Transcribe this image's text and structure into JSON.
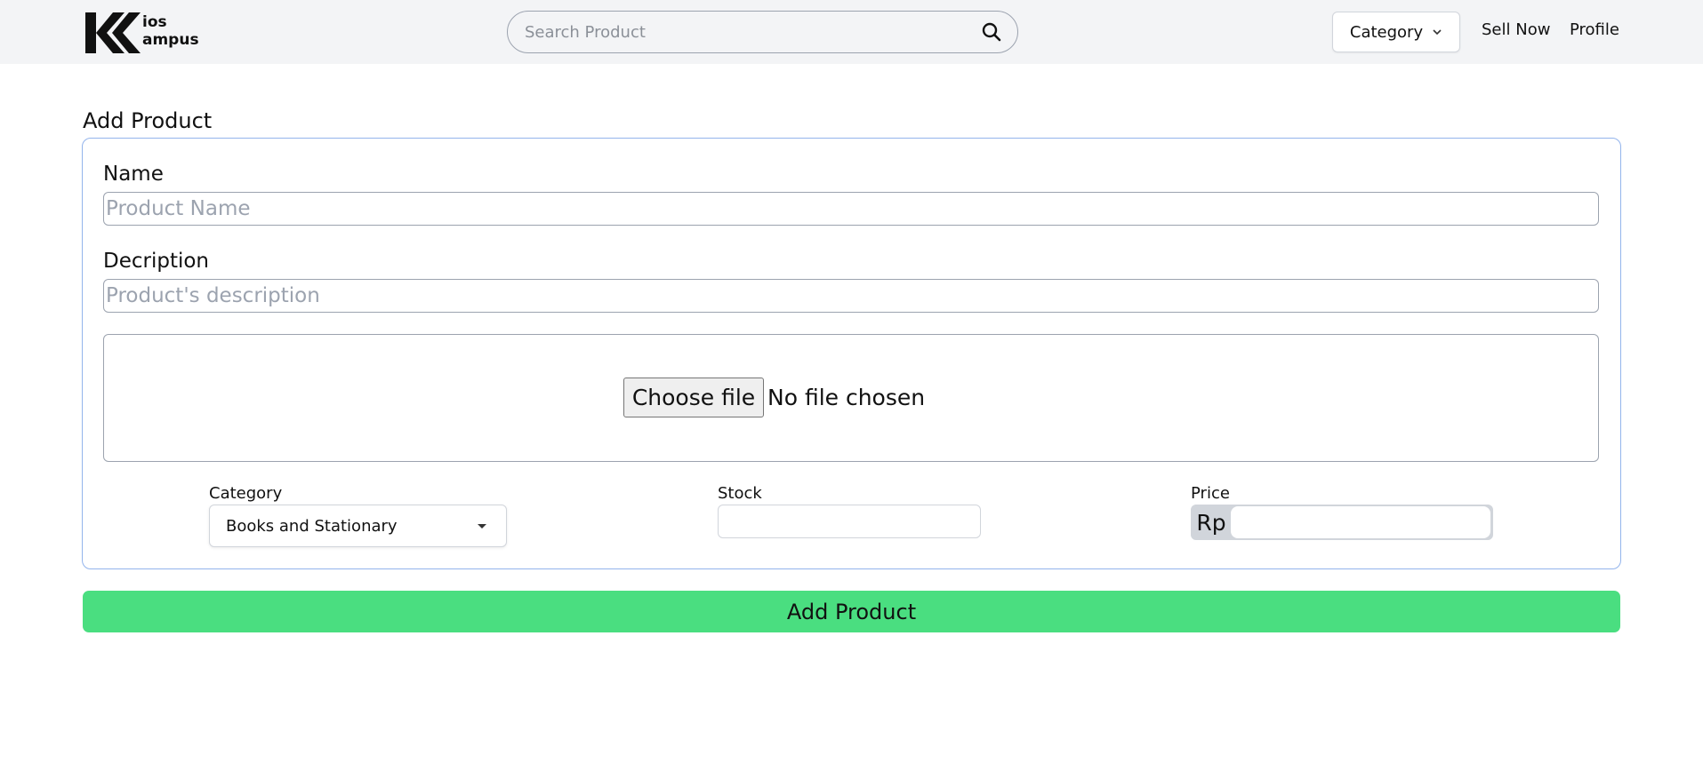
{
  "brand": {
    "line1": "ios",
    "line2": "ampus",
    "mark": "K"
  },
  "search": {
    "placeholder": "Search Product",
    "icon": "search-icon"
  },
  "nav": {
    "category_label": "Category",
    "sell_label": "Sell Now",
    "profile_label": "Profile"
  },
  "form": {
    "title": "Add Product",
    "name_label": "Name",
    "name_placeholder": "Product Name",
    "description_label": "Decription",
    "description_placeholder": "Product's description",
    "file_button": "Choose file",
    "file_status": "No file chosen",
    "category_label": "Category",
    "category_value": "Books and Stationary",
    "stock_label": "Stock",
    "price_label": "Price",
    "price_prefix": "Rp",
    "submit_label": "Add Product"
  },
  "colors": {
    "header_bg": "#f3f4f6",
    "card_border": "#93b4ec",
    "submit_bg": "#4ade80"
  }
}
